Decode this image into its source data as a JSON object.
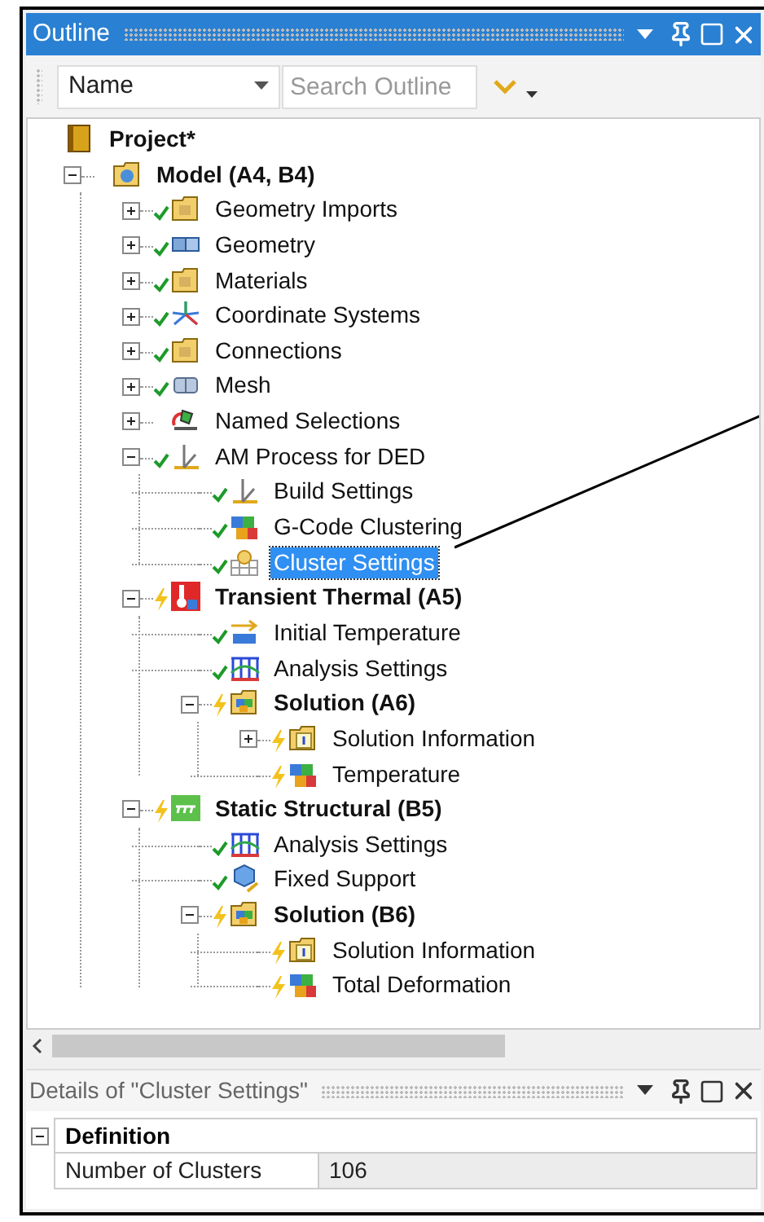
{
  "outline": {
    "title": "Outline",
    "toolbar": {
      "filter": "Name",
      "search": {
        "placeholder": "Search Outline"
      }
    },
    "tree": [
      {
        "label": "Project*",
        "bold": true,
        "kind": "project",
        "selected": false,
        "children": [
          {
            "label": "Model (A4, B4)",
            "bold": true,
            "kind": "model",
            "selected": false,
            "expanded": true,
            "children": [
              {
                "label": "Geometry Imports",
                "bold": false,
                "kind": "folder",
                "solved": true,
                "outdated": false,
                "selected": false,
                "expanded": false
              },
              {
                "label": "Geometry",
                "bold": false,
                "kind": "geometry",
                "solved": true,
                "outdated": false,
                "selected": false,
                "expanded": false
              },
              {
                "label": "Materials",
                "bold": false,
                "kind": "folder",
                "solved": true,
                "outdated": false,
                "selected": false,
                "expanded": false
              },
              {
                "label": "Coordinate Systems",
                "bold": false,
                "kind": "coordinates",
                "solved": true,
                "outdated": false,
                "selected": false,
                "expanded": false
              },
              {
                "label": "Connections",
                "bold": false,
                "kind": "folder",
                "solved": true,
                "outdated": false,
                "selected": false,
                "expanded": false
              },
              {
                "label": "Mesh",
                "bold": false,
                "kind": "mesh",
                "solved": true,
                "outdated": false,
                "selected": false,
                "expanded": false
              },
              {
                "label": "Named Selections",
                "bold": false,
                "kind": "selection",
                "solved": false,
                "outdated": false,
                "selected": false,
                "expanded": false
              },
              {
                "label": "AM Process for DED",
                "bold": false,
                "kind": "process",
                "solved": true,
                "outdated": false,
                "selected": false,
                "expanded": true,
                "children": [
                  {
                    "label": "Build Settings",
                    "bold": false,
                    "kind": "process",
                    "solved": true,
                    "outdated": false,
                    "selected": false
                  },
                  {
                    "label": "G-Code Clustering",
                    "bold": false,
                    "kind": "result",
                    "solved": true,
                    "outdated": false,
                    "selected": false
                  },
                  {
                    "label": "Cluster Settings",
                    "bold": false,
                    "kind": "grid",
                    "solved": true,
                    "outdated": false,
                    "selected": true
                  }
                ]
              },
              {
                "label": "Transient Thermal (A5)",
                "bold": true,
                "kind": "thermal",
                "solved": false,
                "outdated": true,
                "selected": false,
                "expanded": true,
                "children": [
                  {
                    "label": "Initial Temperature",
                    "bold": false,
                    "kind": "arrow",
                    "solved": true,
                    "outdated": false,
                    "selected": false
                  },
                  {
                    "label": "Analysis Settings",
                    "bold": false,
                    "kind": "settings",
                    "solved": true,
                    "outdated": false,
                    "selected": false
                  },
                  {
                    "label": "Solution (A6)",
                    "bold": true,
                    "kind": "solution",
                    "solved": false,
                    "outdated": true,
                    "selected": false,
                    "expanded": true,
                    "children": [
                      {
                        "label": "Solution Information",
                        "bold": false,
                        "kind": "info",
                        "solved": false,
                        "outdated": true,
                        "selected": false,
                        "expanded": false
                      },
                      {
                        "label": "Temperature",
                        "bold": false,
                        "kind": "result",
                        "solved": false,
                        "outdated": true,
                        "selected": false
                      }
                    ]
                  }
                ]
              },
              {
                "label": "Static Structural (B5)",
                "bold": true,
                "kind": "structural",
                "solved": false,
                "outdated": true,
                "selected": false,
                "expanded": true,
                "children": [
                  {
                    "label": "Analysis Settings",
                    "bold": false,
                    "kind": "settings",
                    "solved": true,
                    "outdated": false,
                    "selected": false
                  },
                  {
                    "label": "Fixed Support",
                    "bold": false,
                    "kind": "support",
                    "solved": true,
                    "outdated": false,
                    "selected": false
                  },
                  {
                    "label": "Solution (B6)",
                    "bold": true,
                    "kind": "solution",
                    "solved": false,
                    "outdated": true,
                    "selected": false,
                    "expanded": true,
                    "children": [
                      {
                        "label": "Solution Information",
                        "bold": false,
                        "kind": "info",
                        "solved": false,
                        "outdated": true,
                        "selected": false
                      },
                      {
                        "label": "Total Deformation",
                        "bold": false,
                        "kind": "result",
                        "solved": false,
                        "outdated": true,
                        "selected": false
                      }
                    ]
                  }
                ]
              }
            ]
          }
        ]
      }
    ]
  },
  "details": {
    "title": "Details of \"Cluster Settings\"",
    "groups": [
      {
        "label": "Definition",
        "expanded": true,
        "rows": [
          {
            "name": "Number of Clusters",
            "value": "106"
          }
        ]
      }
    ]
  }
}
